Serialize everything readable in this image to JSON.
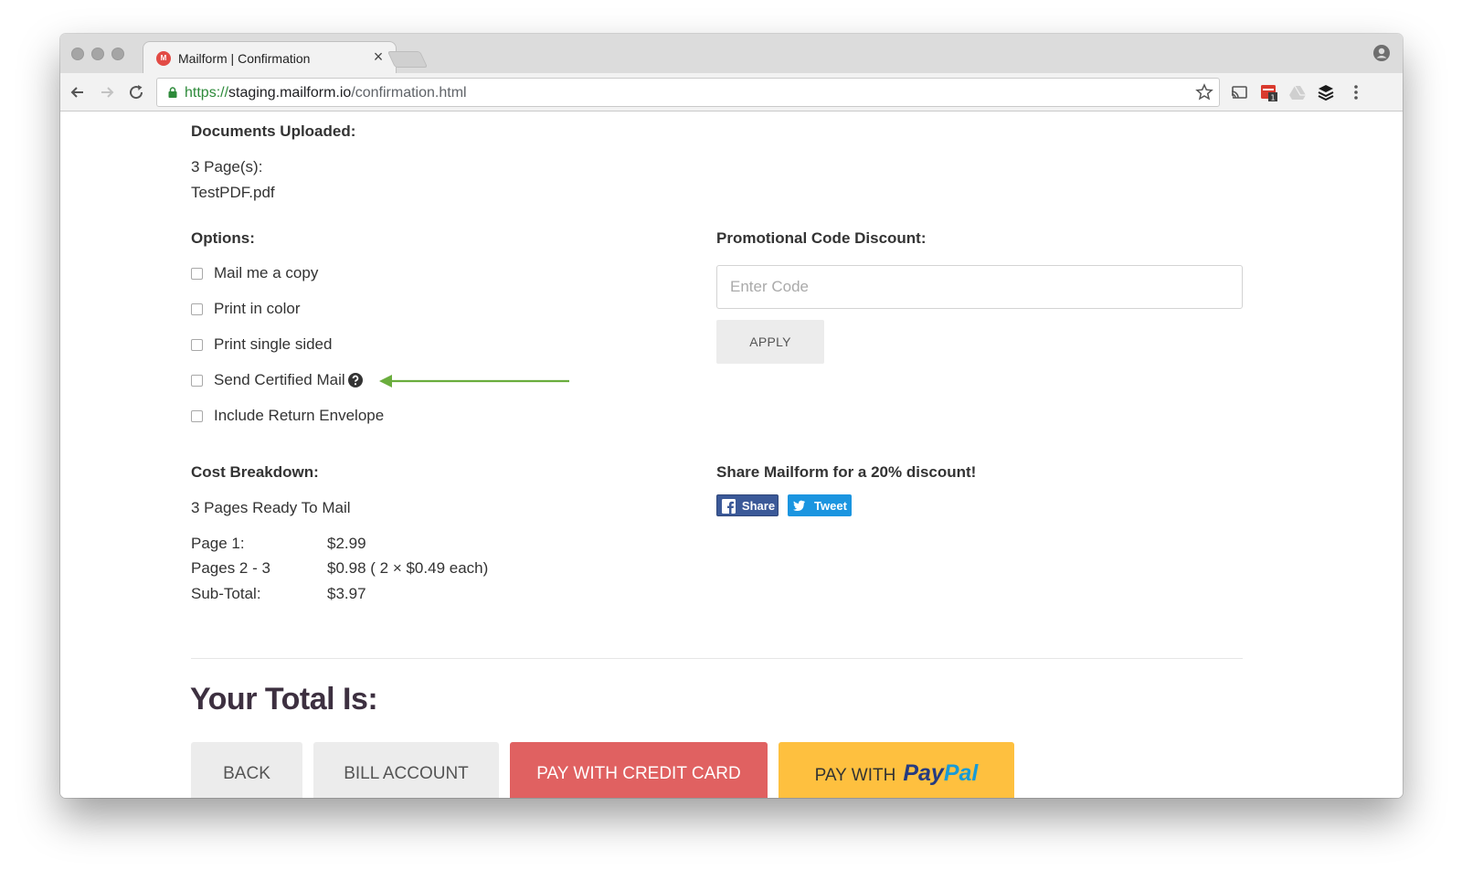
{
  "browser": {
    "tab": {
      "title": "Mailform | Confirmation",
      "favicon_text": "M",
      "close_glyph": "×"
    },
    "url": {
      "scheme": "https://",
      "host": "staging.mailform.io",
      "path": "/confirmation.html"
    },
    "extension_badge": "1"
  },
  "documents": {
    "heading": "Documents Uploaded:",
    "pages": "3 Page(s):",
    "file": "TestPDF.pdf"
  },
  "options": {
    "heading": "Options:",
    "items": [
      {
        "label": "Mail me a copy",
        "checked": false
      },
      {
        "label": "Print in color",
        "checked": false
      },
      {
        "label": "Print single sided",
        "checked": false
      },
      {
        "label": "Send Certified Mail",
        "checked": false,
        "has_help_icon": true
      },
      {
        "label": "Include Return Envelope",
        "checked": false
      }
    ]
  },
  "promo": {
    "heading": "Promotional Code Discount:",
    "placeholder": "Enter Code",
    "value": "",
    "apply_label": "APPLY"
  },
  "cost": {
    "heading": "Cost Breakdown:",
    "summary": "3 Pages Ready To Mail",
    "rows": [
      {
        "label": "Page 1:",
        "value": "$2.99"
      },
      {
        "label": "Pages 2 - 3",
        "value": "$0.98 ( 2 × $0.49 each)"
      },
      {
        "label": "Sub-Total:",
        "value": "$3.97"
      }
    ]
  },
  "share": {
    "heading": "Share Mailform for a 20% discount!",
    "facebook_label": "Share",
    "twitter_label": "Tweet"
  },
  "total": {
    "heading": "Your Total Is:"
  },
  "actions": {
    "back": "BACK",
    "bill": "BILL ACCOUNT",
    "credit": "PAY WITH CREDIT CARD",
    "paypal_prefix": "PAY WITH",
    "paypal_logo_a": "Pay",
    "paypal_logo_b": "Pal"
  },
  "colors": {
    "arrow": "#6aad3d",
    "credit_button": "#e06161",
    "paypal_button": "#fec03f",
    "facebook": "#3b5998",
    "twitter": "#1b95e0"
  },
  "icons": [
    "lock-icon",
    "star-icon",
    "cast-icon",
    "calendar-icon",
    "drive-icon",
    "buffer-icon",
    "menu-icon",
    "help-icon",
    "arrow-annotation",
    "facebook-icon",
    "twitter-icon",
    "profile-icon"
  ]
}
